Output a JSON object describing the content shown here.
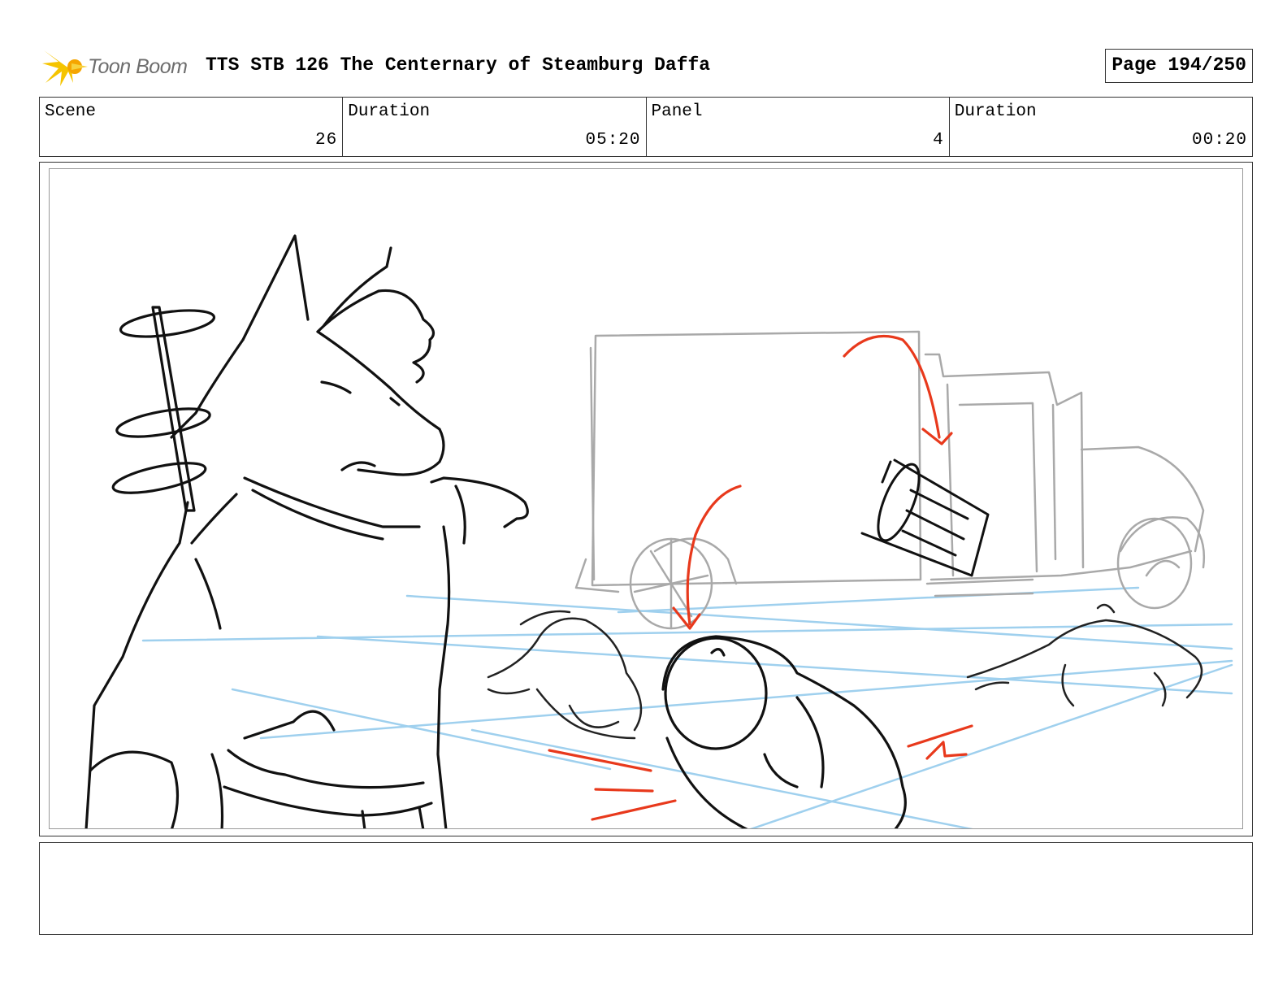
{
  "header": {
    "logo_text": "Toon Boom",
    "logo_icon": "starburst-logo-icon",
    "title": "TTS STB 126 The Centernary of Steamburg Daffa",
    "page": "Page 194/250"
  },
  "info": {
    "scene_label": "Scene",
    "scene_value": "26",
    "scene_duration_label": "Duration",
    "scene_duration_value": "05:20",
    "panel_label": "Panel",
    "panel_value": "4",
    "panel_duration_label": "Duration",
    "panel_duration_value": "00:20"
  },
  "colors": {
    "ink": "#111111",
    "background_sketch": "#a9a9a9",
    "perspective_lines": "#9fd0ee",
    "action_marks": "#e8391c",
    "logo_yellow": "#f5c400"
  },
  "notes": {
    "text": ""
  }
}
